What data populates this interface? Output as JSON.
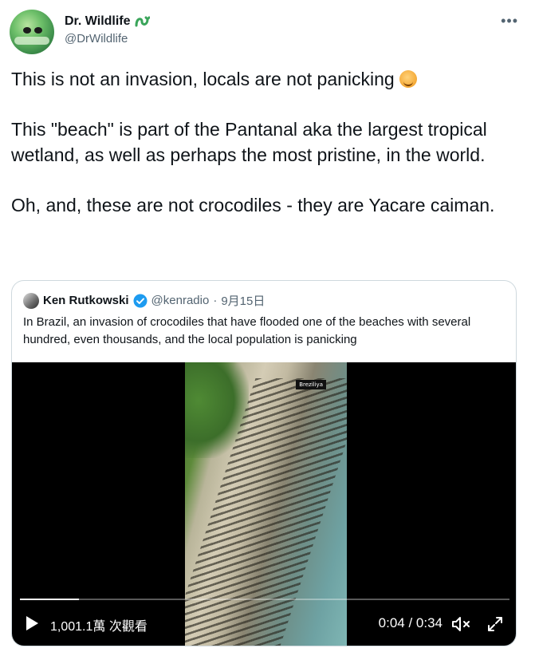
{
  "author": {
    "display_name": "Dr. Wildlife",
    "handle": "@DrWildlife",
    "avatar_icon": "avatar-image",
    "badge_icon": "snake-emoji-icon"
  },
  "menu_icon": "more-options-icon",
  "tweet": {
    "paragraphs": [
      "This is not an invasion, locals are not panicking",
      "This \"beach\" is part of the Pantanal aka the largest tropical wetland, as well as perhaps the most pristine, in the world.",
      "Oh, and, these are not crocodiles - they are Yacare caiman."
    ],
    "emoji": "face-palm-emoji"
  },
  "quote": {
    "name": "Ken Rutkowski",
    "handle": "@kenradio",
    "separator": "·",
    "date": "9月15日",
    "verified": true,
    "text": "In Brazil, an invasion of crocodiles that have flooded one of the beaches with several hundred, even thousands, and the local population is panicking",
    "video": {
      "overlay_tag": "Breziliya",
      "views": "1,001.1萬 次觀看",
      "time": "0:04 / 0:34",
      "progress": 0.12
    }
  },
  "colors": {
    "text": "#0f1419",
    "secondary": "#536471",
    "border": "#cfd9de",
    "verified": "#1d9bf0",
    "video_bg": "#000000"
  }
}
